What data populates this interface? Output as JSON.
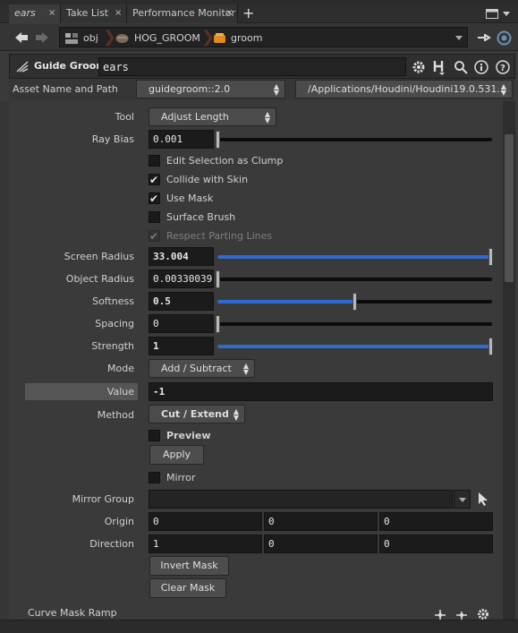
{
  "tabs": [
    {
      "label": "ears",
      "active": true
    },
    {
      "label": "Take List",
      "active": false
    },
    {
      "label": "Performance Monitor",
      "active": false
    }
  ],
  "tab_close": "×",
  "add_tab": "+",
  "nav": {
    "path": [
      "obj",
      "HOG_GROOM",
      "groom"
    ]
  },
  "header": {
    "node_type": "Guide Groom",
    "node_name": "ears"
  },
  "asset": {
    "label": "Asset Name and Path",
    "name": "guidegroom::2.0",
    "path": "/Applications/Houdini/Houdini19.0.531..."
  },
  "params": {
    "tool": {
      "label": "Tool",
      "value": "Adjust Length"
    },
    "ray_bias": {
      "label": "Ray Bias",
      "value": "0.001",
      "level": 0
    },
    "edit_selection": {
      "label": "Edit Selection as Clump",
      "checked": false
    },
    "collide": {
      "label": "Collide with Skin",
      "checked": true
    },
    "use_mask": {
      "label": "Use Mask",
      "checked": true
    },
    "surface_brush": {
      "label": "Surface Brush",
      "checked": false
    },
    "parting": {
      "label": "Respect Parting Lines",
      "checked": true,
      "disabled": true
    },
    "screen_radius": {
      "label": "Screen Radius",
      "value": "33.004",
      "level": 1
    },
    "object_radius": {
      "label": "Object Radius",
      "value": "0.00330039",
      "level": 0
    },
    "softness": {
      "label": "Softness",
      "value": "0.5",
      "level": 0.5
    },
    "spacing": {
      "label": "Spacing",
      "value": "0",
      "level": 0
    },
    "strength": {
      "label": "Strength",
      "value": "1",
      "level": 1
    },
    "mode": {
      "label": "Mode",
      "value": "Add / Subtract"
    },
    "value": {
      "label": "Value",
      "value": "-1"
    },
    "method": {
      "label": "Method",
      "value": "Cut / Extend"
    },
    "preview": {
      "label": "Preview",
      "checked": false
    },
    "apply": {
      "label": "Apply"
    },
    "mirror": {
      "label": "Mirror",
      "checked": false
    },
    "mirror_group": {
      "label": "Mirror Group",
      "value": ""
    },
    "origin": {
      "label": "Origin",
      "values": [
        "0",
        "0",
        "0"
      ]
    },
    "direction": {
      "label": "Direction",
      "values": [
        "1",
        "0",
        "0"
      ]
    },
    "invert_mask": {
      "label": "Invert Mask"
    },
    "clear_mask": {
      "label": "Clear Mask"
    },
    "curve_mask_ramp": {
      "label": "Curve Mask Ramp"
    }
  },
  "icons": [
    "back-arrow-icon",
    "forward-arrow-icon",
    "pin-icon",
    "gear-icon",
    "houdini-help-icon",
    "search-icon",
    "info-icon",
    "help-icon",
    "add-point-icon",
    "remove-point-icon"
  ]
}
